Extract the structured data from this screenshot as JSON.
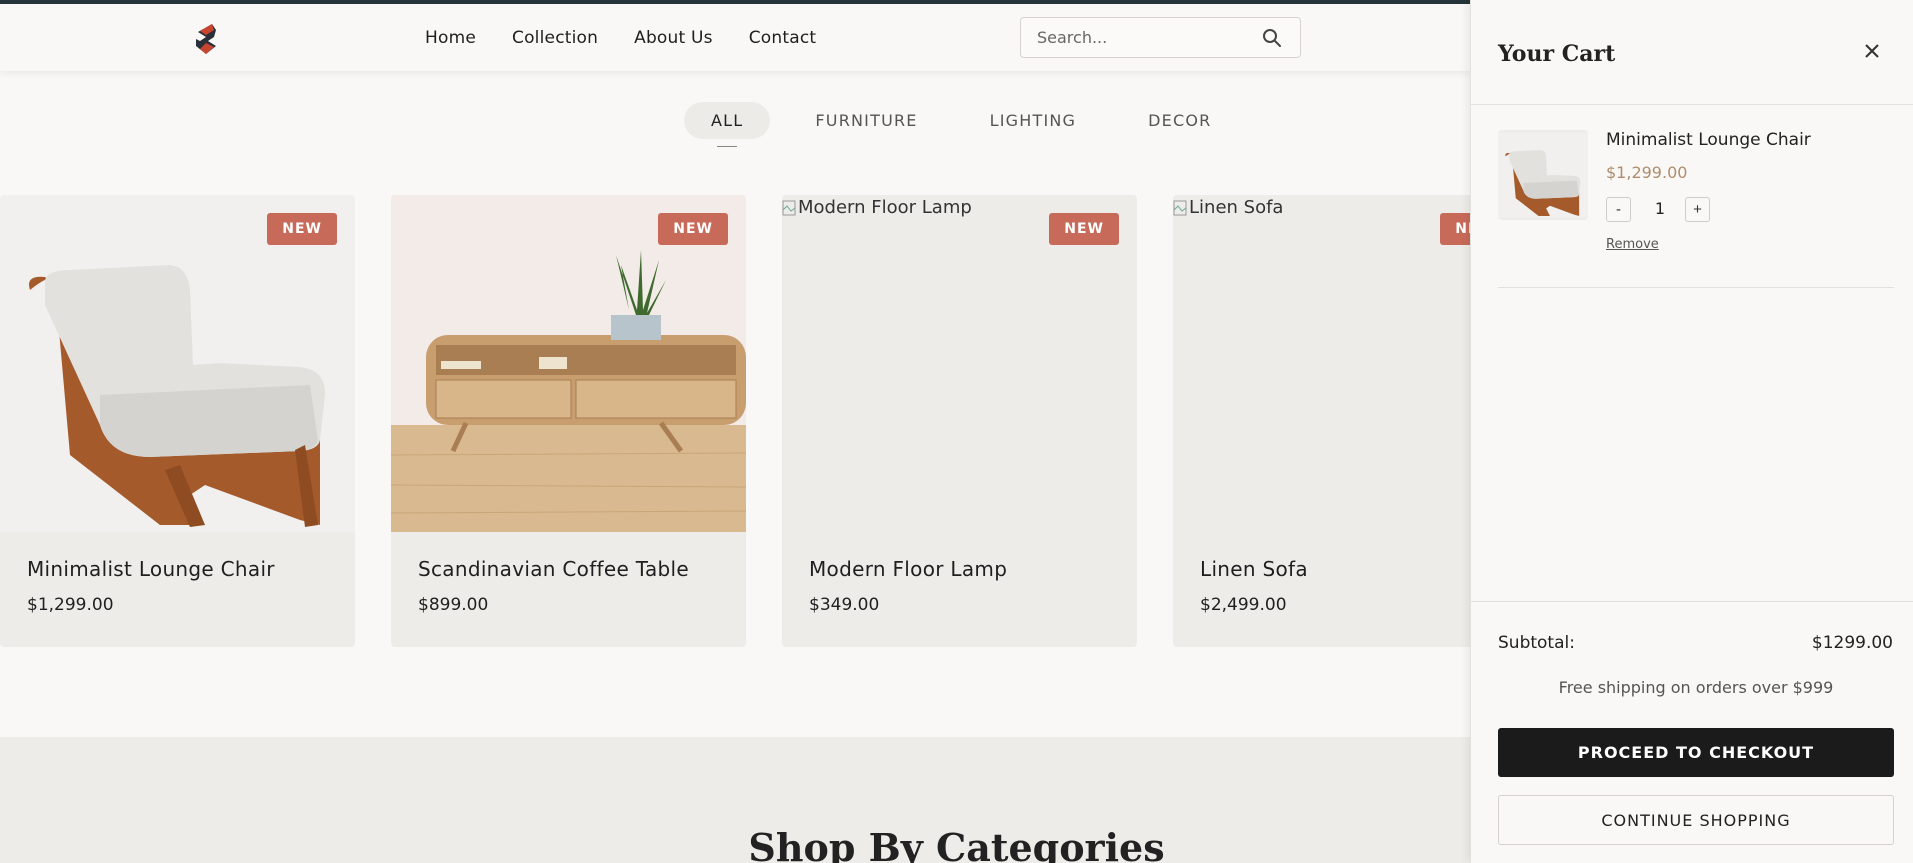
{
  "nav": {
    "items": [
      "Home",
      "Collection",
      "About Us",
      "Contact"
    ]
  },
  "search": {
    "placeholder": "Search..."
  },
  "filters": [
    "ALL",
    "FURNITURE",
    "LIGHTING",
    "DECOR"
  ],
  "active_filter": "ALL",
  "products": [
    {
      "name": "Minimalist Lounge Chair",
      "price": "$1,299.00",
      "badge": "NEW",
      "image_alt": ""
    },
    {
      "name": "Scandinavian Coffee Table",
      "price": "$899.00",
      "badge": "NEW",
      "image_alt": ""
    },
    {
      "name": "Modern Floor Lamp",
      "price": "$349.00",
      "badge": "NEW",
      "image_alt": "Modern Floor Lamp"
    },
    {
      "name": "Linen Sofa",
      "price": "$2,499.00",
      "badge": "NEW",
      "image_alt": "Linen Sofa"
    }
  ],
  "categories": {
    "title": "Shop By Categories"
  },
  "cart": {
    "title": "Your Cart",
    "item": {
      "name": "Minimalist Lounge Chair",
      "price": "$1,299.00",
      "quantity": "1",
      "decrement": "-",
      "increment": "+",
      "remove": "Remove"
    },
    "subtotal_label": "Subtotal:",
    "subtotal_value": "$1299.00",
    "shipping_note": "Free shipping on orders over $999",
    "checkout_label": "PROCEED TO CHECKOUT",
    "continue_label": "CONTINUE SHOPPING"
  },
  "colors": {
    "badge": "#c86a5a",
    "accent_price": "#b08d6e",
    "checkout_bg": "#1b1b1b",
    "topbar": "#27363a"
  }
}
